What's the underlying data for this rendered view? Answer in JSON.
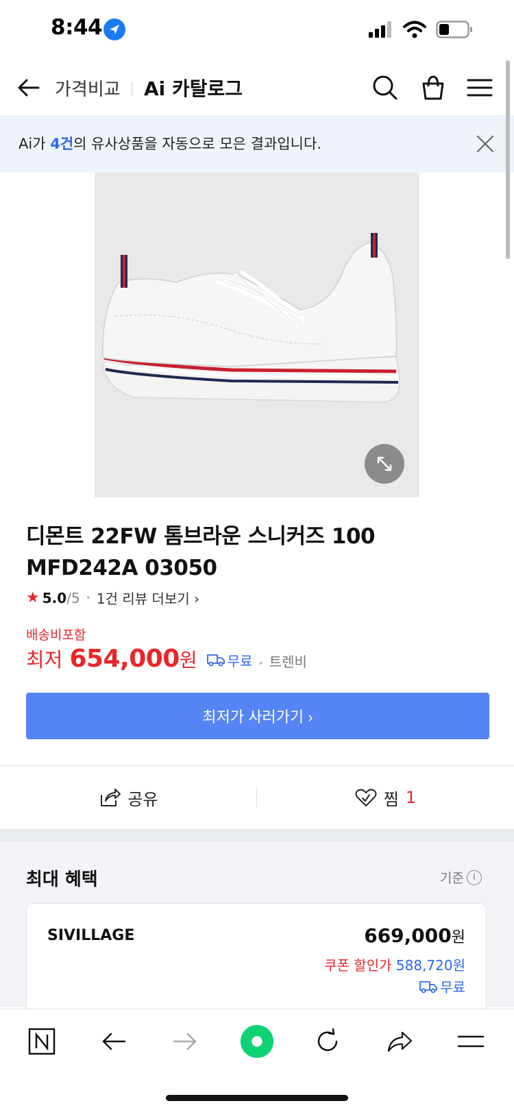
{
  "status_bar": {
    "time": "8:44"
  },
  "nav": {
    "title_1": "가격비교",
    "title_2": "Ai 카탈로그"
  },
  "ai_banner": {
    "prefix": "Ai가 ",
    "count": "4건",
    "suffix": "의 유사상품을 자동으로 모은 결과입니다."
  },
  "product": {
    "name": "디몬트 22FW 톰브라운 스니커즈 100 MFD242A 03050",
    "rating": "5.0",
    "rating_max": "/5",
    "review_link": "1건 리뷰 더보기 ›",
    "shipping_included": "배송비포함",
    "price_label": "최저",
    "price_value": "654,000",
    "price_unit": "원",
    "free_shipping": "무료",
    "seller": "트렌비",
    "buy_button": "최저가 사러가기 ›"
  },
  "actions": {
    "share": "공유",
    "like": "찜",
    "like_count": "1"
  },
  "benefits": {
    "title": "최대 혜택",
    "basis": "기준",
    "offer": {
      "seller": "SIVILLAGE",
      "price": "669,000",
      "price_unit": "원",
      "coupon_label": "쿠폰 할인가 ",
      "coupon_price": "588,720원",
      "shipping": "무료"
    }
  },
  "colors": {
    "accent_red": "#e8262a",
    "accent_blue": "#2c67f0",
    "button_blue": "#5585f5",
    "banner_bg": "#eff4fb"
  }
}
